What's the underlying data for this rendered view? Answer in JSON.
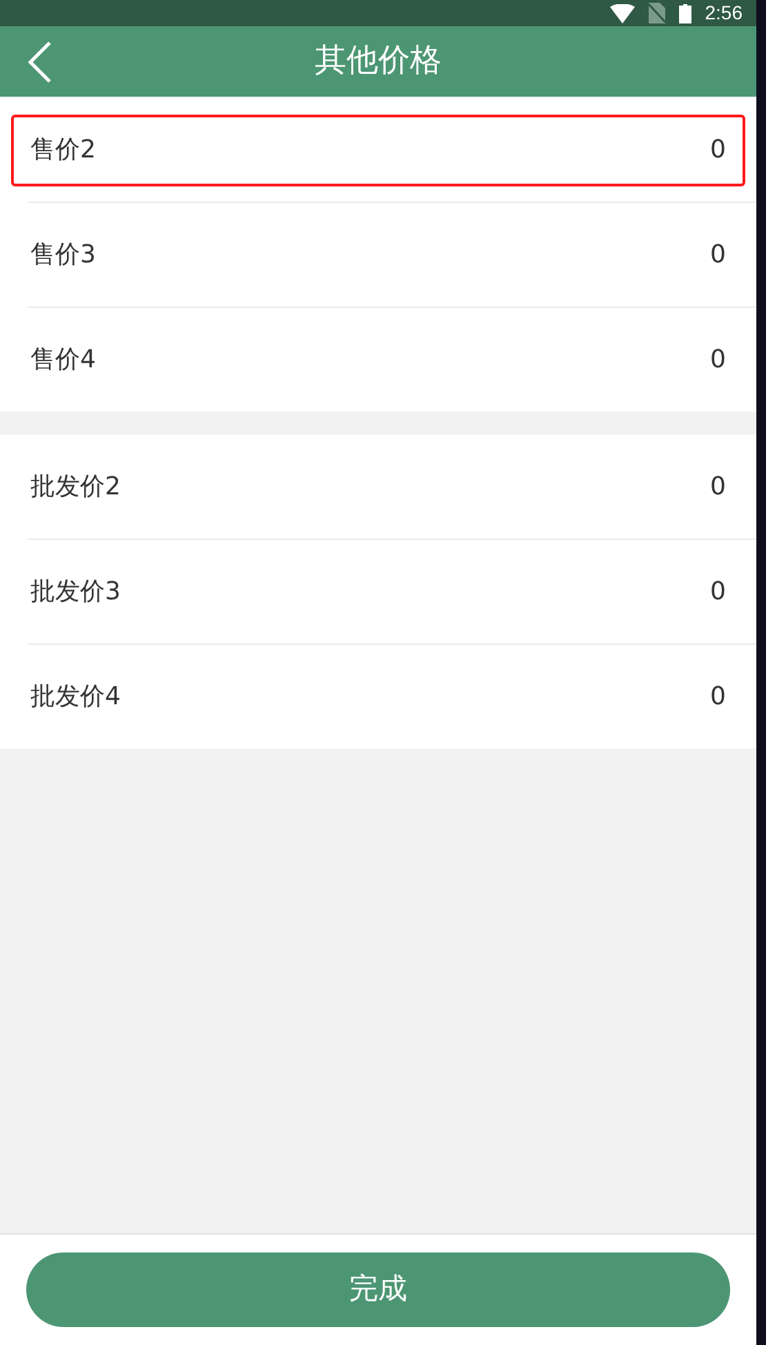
{
  "status_bar": {
    "time": "2:56"
  },
  "header": {
    "title": "其他价格"
  },
  "sections": [
    {
      "rows": [
        {
          "label": "售价2",
          "value": "0",
          "highlighted": true
        },
        {
          "label": "售价3",
          "value": "0",
          "highlighted": false
        },
        {
          "label": "售价4",
          "value": "0",
          "highlighted": false
        }
      ]
    },
    {
      "rows": [
        {
          "label": "批发价2",
          "value": "0",
          "highlighted": false
        },
        {
          "label": "批发价3",
          "value": "0",
          "highlighted": false
        },
        {
          "label": "批发价4",
          "value": "0",
          "highlighted": false
        }
      ]
    }
  ],
  "footer": {
    "button": "完成"
  }
}
